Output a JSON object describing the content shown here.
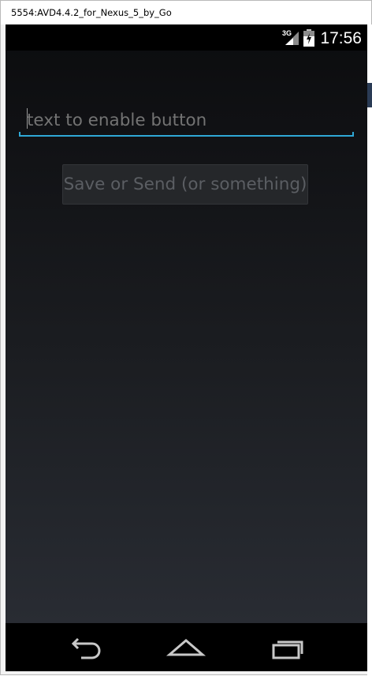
{
  "window": {
    "title": "5554:AVD4.4.2_for_Nexus_5_by_Go"
  },
  "statusbar": {
    "network_type": "3G",
    "time": "17:56",
    "icons": [
      "signal-icon",
      "battery-icon"
    ]
  },
  "form": {
    "input_value": "",
    "input_hint": "text to enable button",
    "button_label": "Save or Send (or something)",
    "button_enabled": false
  },
  "navbar": {
    "icons": [
      "back-icon",
      "home-icon",
      "recents-icon"
    ]
  },
  "colors": {
    "accent": "#2fa8d6",
    "screen_top": "#0b0c0e",
    "screen_bottom": "#292c33",
    "disabled_text": "#5b5e63"
  }
}
